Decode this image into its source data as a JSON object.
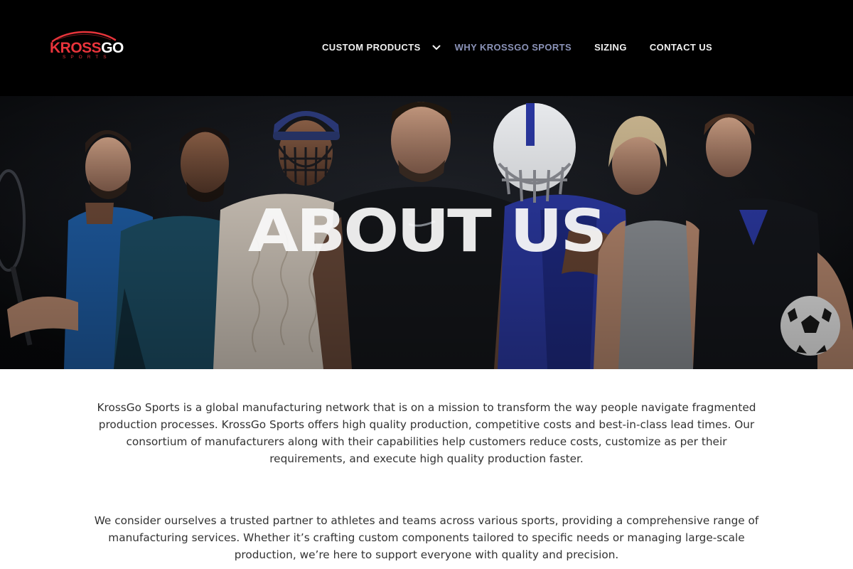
{
  "brand": {
    "logo_main": "KROSS",
    "logo_accent": "GO",
    "logo_sub": "SPORTS",
    "accent_color": "#e8343b"
  },
  "nav": {
    "items": [
      {
        "label": "CUSTOM PRODUCTS",
        "has_dropdown": true
      },
      {
        "label": "WHY KROSSGO SPORTS",
        "active": true
      },
      {
        "label": "SIZING"
      },
      {
        "label": "CONTACT US"
      }
    ],
    "active_color": "#8b93b8"
  },
  "hero": {
    "title": "ABOUT US"
  },
  "content": {
    "paragraphs": [
      "KrossGo Sports is a global manufacturing network that is on a mission to transform the way people navigate fragmented production processes. KrossGo Sports offers high quality production, competitive costs and best-in-class lead times. Our consortium of manufacturers along with their capabilities help customers reduce costs, customize as per their requirements, and execute high quality production faster.",
      "We consider ourselves a trusted partner to athletes and teams across various sports, providing a comprehensive range of manufacturing services. Whether it’s crafting custom components tailored to specific needs or managing large-scale production, we’re here to support everyone with quality and precision."
    ]
  }
}
